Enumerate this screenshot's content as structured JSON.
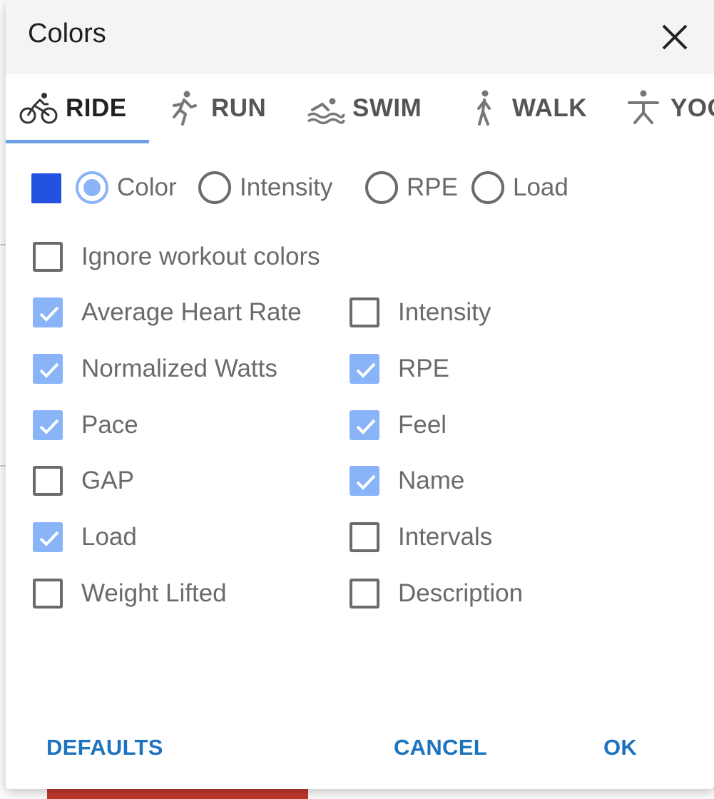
{
  "dialog": {
    "title": "Colors",
    "close_icon": "close-icon"
  },
  "tabs": [
    {
      "label": "RIDE",
      "icon": "bike-icon",
      "active": true
    },
    {
      "label": "RUN",
      "icon": "run-icon",
      "active": false
    },
    {
      "label": "SWIM",
      "icon": "swim-icon",
      "active": false
    },
    {
      "label": "WALK",
      "icon": "walk-icon",
      "active": false
    },
    {
      "label": "YOGA",
      "icon": "yoga-icon",
      "active": false
    }
  ],
  "color_mode": {
    "swatch_color": "#2352e0",
    "options": [
      {
        "label": "Color",
        "selected": true
      },
      {
        "label": "Intensity",
        "selected": false
      },
      {
        "label": "RPE",
        "selected": false
      },
      {
        "label": "Load",
        "selected": false
      }
    ]
  },
  "ignore_workout_colors": {
    "label": "Ignore workout colors",
    "checked": false
  },
  "fields_left": [
    {
      "label": "Average Heart Rate",
      "checked": true
    },
    {
      "label": "Normalized Watts",
      "checked": true
    },
    {
      "label": "Pace",
      "checked": true
    },
    {
      "label": "GAP",
      "checked": false
    },
    {
      "label": "Load",
      "checked": true
    },
    {
      "label": "Weight Lifted",
      "checked": false
    }
  ],
  "fields_right": [
    {
      "label": "Intensity",
      "checked": false
    },
    {
      "label": "RPE",
      "checked": true
    },
    {
      "label": "Feel",
      "checked": true
    },
    {
      "label": "Name",
      "checked": true
    },
    {
      "label": "Intervals",
      "checked": false
    },
    {
      "label": "Description",
      "checked": false
    }
  ],
  "footer": {
    "defaults_label": "DEFAULTS",
    "cancel_label": "CANCEL",
    "ok_label": "OK"
  },
  "colors": {
    "accent": "#8ab4f8",
    "button_text": "#1e73be",
    "tab_indicator": "#6ea0e8"
  }
}
